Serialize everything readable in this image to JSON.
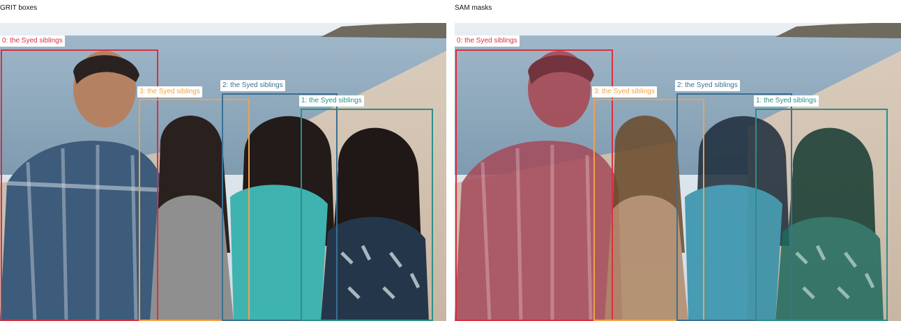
{
  "panels": {
    "left": {
      "title": "GRIT boxes"
    },
    "right": {
      "title": "SAM masks"
    }
  },
  "detections": [
    {
      "label": "0: the Syed siblings",
      "color": "#d8303f"
    },
    {
      "label": "1: the Syed siblings",
      "color": "#2a8f8a"
    },
    {
      "label": "2: the Syed siblings",
      "color": "#3a6f93"
    },
    {
      "label": "3: the Syed siblings",
      "color": "#f0a24a"
    }
  ],
  "mask_colors": {
    "0": "#c0303f",
    "1": "#1f8a7a",
    "2": "#2f6f95",
    "3": "#d48a3a"
  }
}
